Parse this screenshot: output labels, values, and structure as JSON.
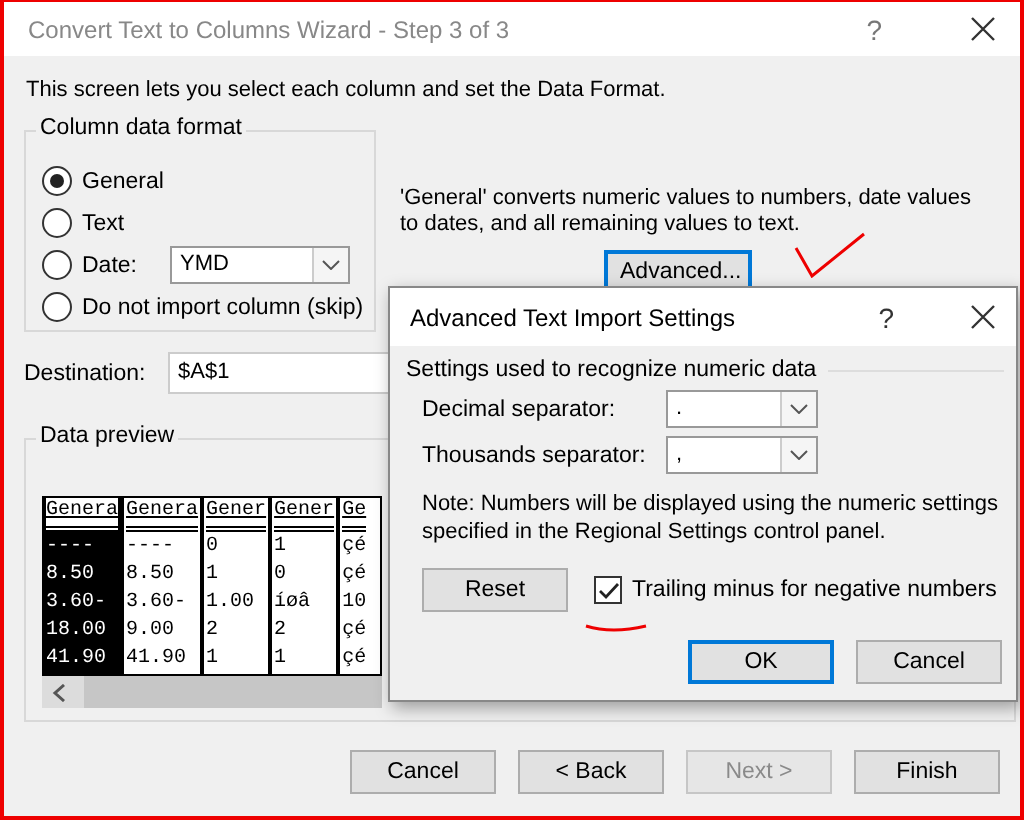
{
  "window": {
    "title": "Convert Text to Columns Wizard - Step 3 of 3",
    "help": "?"
  },
  "instruction": "This screen lets you select each column and set the Data Format.",
  "column_data_format": {
    "label": "Column data format",
    "options": [
      {
        "kind": "plain",
        "label": "General",
        "selected": true
      },
      {
        "kind": "plain",
        "label": "Text",
        "selected": false
      },
      {
        "kind": "date",
        "label": "Date:",
        "selected": false,
        "dropdown_value": "YMD"
      },
      {
        "kind": "plain",
        "label": "Do not import column (skip)",
        "selected": false
      }
    ]
  },
  "description": "'General' converts numeric values to numbers, date values to dates, and all remaining values to text.",
  "advanced_button": {
    "label": "Advanced...",
    "focused": true
  },
  "destination": {
    "label": "Destination:",
    "value": "$A$1"
  },
  "data_preview": {
    "label": "Data preview",
    "columns": [
      {
        "header": "Genera",
        "selected": true
      },
      {
        "header": "Genera",
        "selected": false
      },
      {
        "header": "Gener",
        "selected": false
      },
      {
        "header": "Gener",
        "selected": false
      },
      {
        "header": "Ge",
        "selected": false
      }
    ],
    "rows": [
      [
        "----",
        "----",
        "0",
        "1",
        "çé"
      ],
      [
        "8.50",
        "8.50",
        "1",
        "0",
        "çé"
      ],
      [
        "3.60-",
        "3.60-",
        "1.00",
        "íøâ",
        "10"
      ],
      [
        "18.00",
        "9.00",
        "2",
        "2",
        "çé"
      ],
      [
        "41.90",
        "41.90",
        "1",
        "1",
        "çé"
      ]
    ]
  },
  "buttons": [
    {
      "label": "Cancel",
      "disabled": false
    },
    {
      "label": "< Back",
      "disabled": false
    },
    {
      "label": "Next >",
      "disabled": true
    },
    {
      "label": "Finish",
      "disabled": false
    }
  ],
  "advanced_dialog": {
    "title": "Advanced Text Import Settings",
    "help": "?",
    "group_label": "Settings used to recognize numeric data",
    "fields": [
      {
        "label": "Decimal separator:",
        "value": "."
      },
      {
        "label": "Thousands separator:",
        "value": ","
      }
    ],
    "note": "Note: Numbers will be displayed using the numeric settings specified in the Regional Settings control panel.",
    "reset_button": "Reset",
    "trailing_minus": {
      "label": "Trailing minus for negative numbers",
      "checked": true
    },
    "buttons": [
      {
        "label": "OK",
        "focused": true
      },
      {
        "label": "Cancel",
        "focused": false
      }
    ]
  }
}
